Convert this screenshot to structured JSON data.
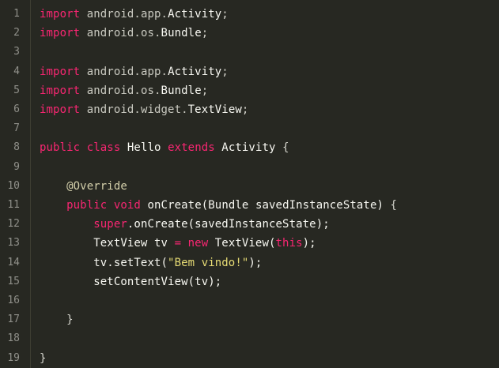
{
  "editor": {
    "colors": {
      "background": "#272822",
      "keyword": "#f92672",
      "string": "#e6db74",
      "text": "#f8f8f2",
      "line_number": "#90908a"
    },
    "lines": [
      {
        "n": "1",
        "tokens": [
          {
            "t": "import",
            "c": "kw"
          },
          {
            "t": " android.app.",
            "c": "pkg"
          },
          {
            "t": "Activity",
            "c": "type"
          },
          {
            "t": ";",
            "c": "punct"
          }
        ]
      },
      {
        "n": "2",
        "tokens": [
          {
            "t": "import",
            "c": "kw"
          },
          {
            "t": " android.os.",
            "c": "pkg"
          },
          {
            "t": "Bundle",
            "c": "type"
          },
          {
            "t": ";",
            "c": "punct"
          }
        ]
      },
      {
        "n": "3",
        "tokens": []
      },
      {
        "n": "4",
        "tokens": [
          {
            "t": "import",
            "c": "kw"
          },
          {
            "t": " android.app.",
            "c": "pkg"
          },
          {
            "t": "Activity",
            "c": "type"
          },
          {
            "t": ";",
            "c": "punct"
          }
        ]
      },
      {
        "n": "5",
        "tokens": [
          {
            "t": "import",
            "c": "kw"
          },
          {
            "t": " android.os.",
            "c": "pkg"
          },
          {
            "t": "Bundle",
            "c": "type"
          },
          {
            "t": ";",
            "c": "punct"
          }
        ]
      },
      {
        "n": "6",
        "tokens": [
          {
            "t": "import",
            "c": "kw"
          },
          {
            "t": " android.widget.",
            "c": "pkg"
          },
          {
            "t": "TextView",
            "c": "type"
          },
          {
            "t": ";",
            "c": "punct"
          }
        ]
      },
      {
        "n": "7",
        "tokens": []
      },
      {
        "n": "8",
        "tokens": [
          {
            "t": "public",
            "c": "kw"
          },
          {
            "t": " ",
            "c": "plain"
          },
          {
            "t": "class",
            "c": "kw"
          },
          {
            "t": " Hello ",
            "c": "plain"
          },
          {
            "t": "extends",
            "c": "kw"
          },
          {
            "t": " Activity ",
            "c": "plain"
          },
          {
            "t": "{",
            "c": "punct"
          }
        ]
      },
      {
        "n": "9",
        "tokens": []
      },
      {
        "n": "10",
        "tokens": [
          {
            "t": "    ",
            "c": "plain"
          },
          {
            "t": "@Override",
            "c": "ann"
          }
        ]
      },
      {
        "n": "11",
        "tokens": [
          {
            "t": "    ",
            "c": "plain"
          },
          {
            "t": "public",
            "c": "kw"
          },
          {
            "t": " ",
            "c": "plain"
          },
          {
            "t": "void",
            "c": "kw"
          },
          {
            "t": " onCreate(Bundle savedInstanceState) ",
            "c": "plain"
          },
          {
            "t": "{",
            "c": "punct"
          }
        ]
      },
      {
        "n": "12",
        "tokens": [
          {
            "t": "        ",
            "c": "plain"
          },
          {
            "t": "super",
            "c": "kw"
          },
          {
            "t": ".onCreate(savedInstanceState);",
            "c": "plain"
          }
        ]
      },
      {
        "n": "13",
        "tokens": [
          {
            "t": "        TextView tv ",
            "c": "plain"
          },
          {
            "t": "=",
            "c": "kw"
          },
          {
            "t": " ",
            "c": "plain"
          },
          {
            "t": "new",
            "c": "kw"
          },
          {
            "t": " TextView(",
            "c": "plain"
          },
          {
            "t": "this",
            "c": "kw"
          },
          {
            "t": ");",
            "c": "plain"
          }
        ]
      },
      {
        "n": "14",
        "tokens": [
          {
            "t": "        tv.setText(",
            "c": "plain"
          },
          {
            "t": "\"Bem vindo!\"",
            "c": "str"
          },
          {
            "t": ");",
            "c": "plain"
          }
        ]
      },
      {
        "n": "15",
        "tokens": [
          {
            "t": "        setContentView(tv);",
            "c": "plain"
          }
        ]
      },
      {
        "n": "16",
        "tokens": []
      },
      {
        "n": "17",
        "tokens": [
          {
            "t": "    ",
            "c": "plain"
          },
          {
            "t": "}",
            "c": "punct"
          }
        ]
      },
      {
        "n": "18",
        "tokens": []
      },
      {
        "n": "19",
        "tokens": [
          {
            "t": "}",
            "c": "punct"
          }
        ]
      }
    ]
  }
}
